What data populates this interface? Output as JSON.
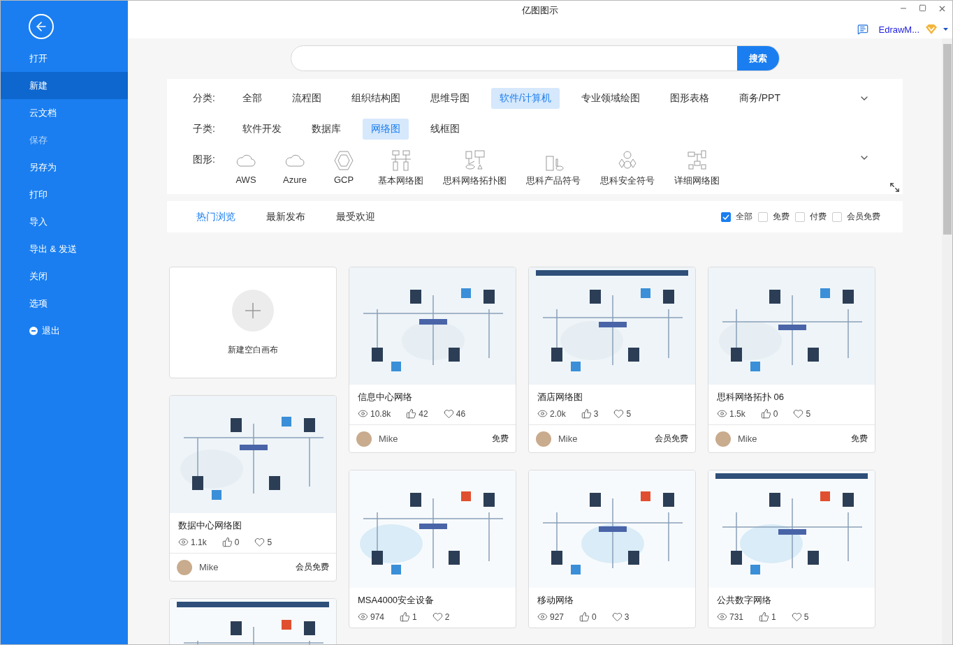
{
  "window": {
    "title": "亿图图示",
    "account": "EdrawM..."
  },
  "sidebar": {
    "items": [
      {
        "label": "打开",
        "selected": false,
        "disabled": false,
        "kind": "plain"
      },
      {
        "label": "新建",
        "selected": true,
        "disabled": false,
        "kind": "plain"
      },
      {
        "label": "云文档",
        "selected": false,
        "disabled": false,
        "kind": "plain"
      },
      {
        "label": "保存",
        "selected": false,
        "disabled": true,
        "kind": "plain"
      },
      {
        "label": "另存为",
        "selected": false,
        "disabled": false,
        "kind": "plain"
      },
      {
        "label": "打印",
        "selected": false,
        "disabled": false,
        "kind": "plain"
      },
      {
        "label": "导入",
        "selected": false,
        "disabled": false,
        "kind": "plain"
      },
      {
        "label": "导出 & 发送",
        "selected": false,
        "disabled": false,
        "kind": "plain"
      },
      {
        "label": "关闭",
        "selected": false,
        "disabled": false,
        "kind": "plain"
      },
      {
        "label": "选项",
        "selected": false,
        "disabled": false,
        "kind": "plain"
      },
      {
        "label": "退出",
        "selected": false,
        "disabled": false,
        "kind": "exit"
      }
    ]
  },
  "search": {
    "button": "搜索"
  },
  "filters": {
    "category": {
      "label": "分类:",
      "options": [
        {
          "label": "全部",
          "selected": false
        },
        {
          "label": "流程图",
          "selected": false
        },
        {
          "label": "组织结构图",
          "selected": false
        },
        {
          "label": "思维导图",
          "selected": false
        },
        {
          "label": "软件/计算机",
          "selected": true
        },
        {
          "label": "专业领域绘图",
          "selected": false
        },
        {
          "label": "图形表格",
          "selected": false
        },
        {
          "label": "商务/PPT",
          "selected": false
        }
      ]
    },
    "subcategory": {
      "label": "子类:",
      "options": [
        {
          "label": "软件开发",
          "selected": false
        },
        {
          "label": "数据库",
          "selected": false
        },
        {
          "label": "网络图",
          "selected": true
        },
        {
          "label": "线框图",
          "selected": false
        }
      ]
    },
    "shapes": {
      "label": "图形:",
      "items": [
        {
          "label": "AWS",
          "kind": "cloud"
        },
        {
          "label": "Azure",
          "kind": "cloud"
        },
        {
          "label": "GCP",
          "kind": "hexagon"
        },
        {
          "label": "基本网络图",
          "kind": "network"
        },
        {
          "label": "思科网络拓扑图",
          "kind": "topology"
        },
        {
          "label": "思科产品符号",
          "kind": "device"
        },
        {
          "label": "思科安全符号",
          "kind": "security"
        },
        {
          "label": "详细网络图",
          "kind": "detail"
        }
      ]
    }
  },
  "sort_tabs": [
    {
      "label": "热门浏览",
      "selected": true
    },
    {
      "label": "最新发布",
      "selected": false
    },
    {
      "label": "最受欢迎",
      "selected": false
    }
  ],
  "price_filters": [
    {
      "label": "全部",
      "checked": true
    },
    {
      "label": "免费",
      "checked": false
    },
    {
      "label": "付费",
      "checked": false
    },
    {
      "label": "会员免费",
      "checked": false
    }
  ],
  "columns": [
    {
      "cards": [
        {
          "kind": "new",
          "title": "新建空白画布"
        },
        {
          "kind": "template",
          "title": "数据中心网络图",
          "views": "1.1k",
          "likes": "0",
          "favorites": "5",
          "author": "Mike",
          "price": "会员免费"
        },
        {
          "kind": "template"
        }
      ]
    },
    {
      "cards": [
        {
          "kind": "template",
          "title": "信息中心网络",
          "views": "10.8k",
          "likes": "42",
          "favorites": "46",
          "author": "Mike",
          "price": "免费"
        },
        {
          "kind": "template",
          "title": "MSA4000安全设备",
          "views": "974",
          "likes": "1",
          "favorites": "2"
        }
      ]
    },
    {
      "cards": [
        {
          "kind": "template",
          "title": "酒店网络图",
          "views": "2.0k",
          "likes": "3",
          "favorites": "5",
          "author": "Mike",
          "price": "会员免费"
        },
        {
          "kind": "template",
          "title": "移动网络",
          "views": "927",
          "likes": "0",
          "favorites": "3"
        }
      ]
    },
    {
      "cards": [
        {
          "kind": "template",
          "title": "思科网络拓扑 06",
          "views": "1.5k",
          "likes": "0",
          "favorites": "5",
          "author": "Mike",
          "price": "免费"
        },
        {
          "kind": "template",
          "title": "公共数字网络",
          "views": "731",
          "likes": "1",
          "favorites": "5"
        }
      ]
    }
  ]
}
